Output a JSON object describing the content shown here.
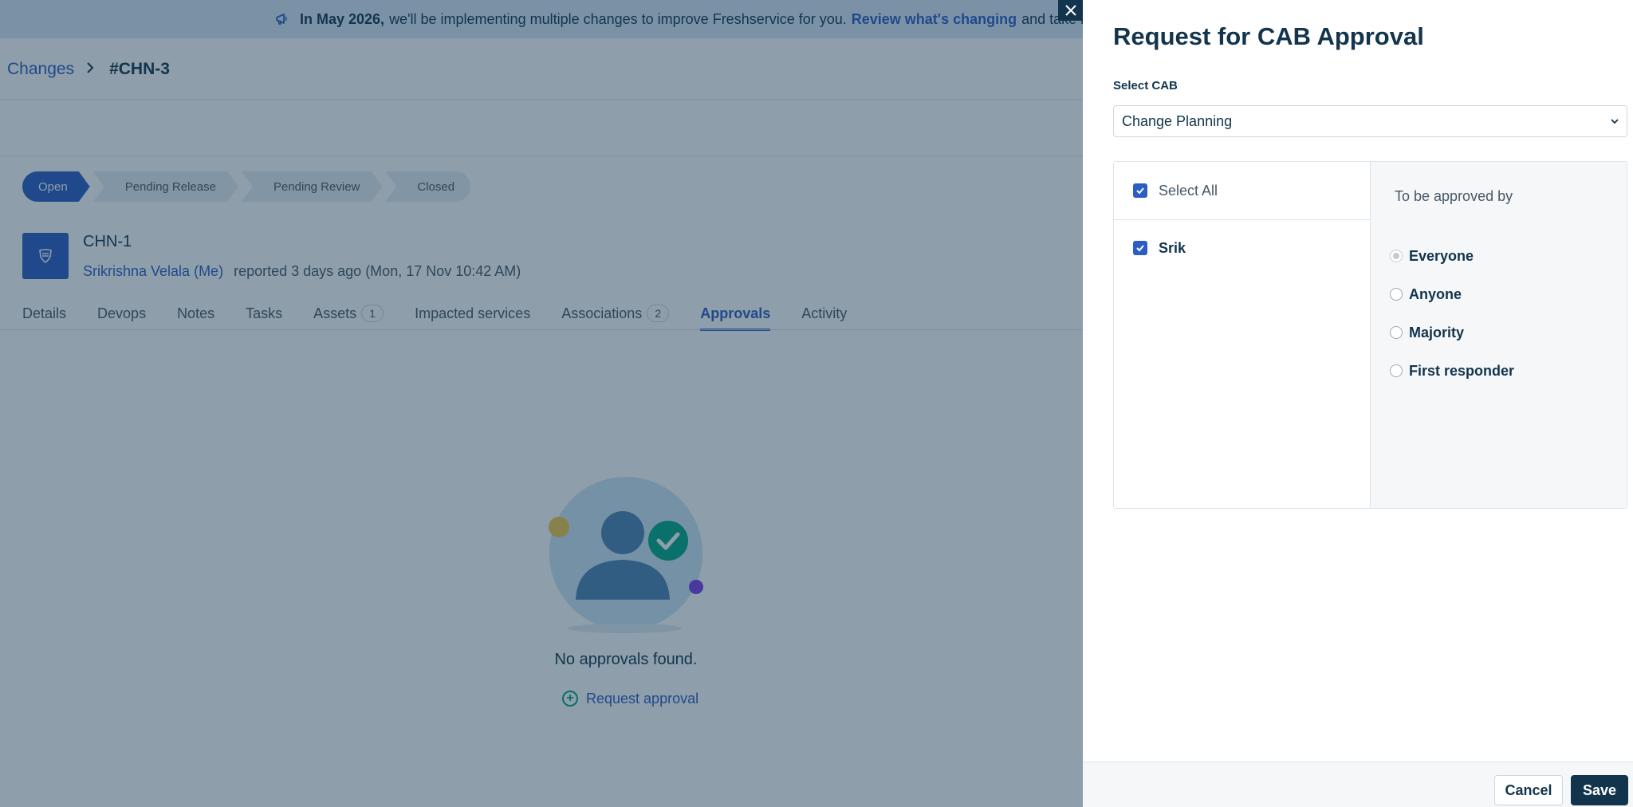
{
  "banner": {
    "bold_text": "In May 2026,",
    "text": "we'll be implementing multiple changes to improve Freshservice for you.",
    "link": "Review what's changing",
    "trailing": "and take in"
  },
  "breadcrumb": {
    "parent": "Changes",
    "current": "#CHN-3"
  },
  "stages": [
    "Open",
    "Pending Release",
    "Pending Review",
    "Closed"
  ],
  "ticket": {
    "id": "CHN-1",
    "reporter": "Srikrishna Velala (Me)",
    "reported": "reported 3 days ago (Mon, 17 Nov 10:42 AM)"
  },
  "tabs": [
    {
      "label": "Details"
    },
    {
      "label": "Devops"
    },
    {
      "label": "Notes"
    },
    {
      "label": "Tasks"
    },
    {
      "label": "Assets",
      "count": "1"
    },
    {
      "label": "Impacted services"
    },
    {
      "label": "Associations",
      "count": "2"
    },
    {
      "label": "Approvals",
      "active": true
    },
    {
      "label": "Activity"
    }
  ],
  "empty_state": {
    "message": "No approvals found.",
    "action": "Request approval"
  },
  "drawer": {
    "title": "Request for CAB Approval",
    "cab_label": "Select CAB",
    "cab_value": "Change Planning",
    "select_all": "Select All",
    "members": [
      {
        "name": "Srik",
        "checked": true
      }
    ],
    "approved_by_label": "To be approved by",
    "approval_options": [
      {
        "label": "Everyone",
        "selected": true
      },
      {
        "label": "Anyone",
        "selected": false
      },
      {
        "label": "Majority",
        "selected": false
      },
      {
        "label": "First responder",
        "selected": false
      }
    ],
    "cancel_label": "Cancel",
    "save_label": "Save"
  },
  "colors": {
    "primary": "#2c5cc5",
    "dark": "#12344d",
    "success": "#00a886"
  },
  "icons": {
    "banner": "megaphone-icon",
    "breadcrumb_sep": "chevron-right-icon",
    "ticket": "change-shield-icon",
    "close": "close-icon",
    "select": "chevron-down-icon",
    "request": "plus-circle-icon"
  }
}
